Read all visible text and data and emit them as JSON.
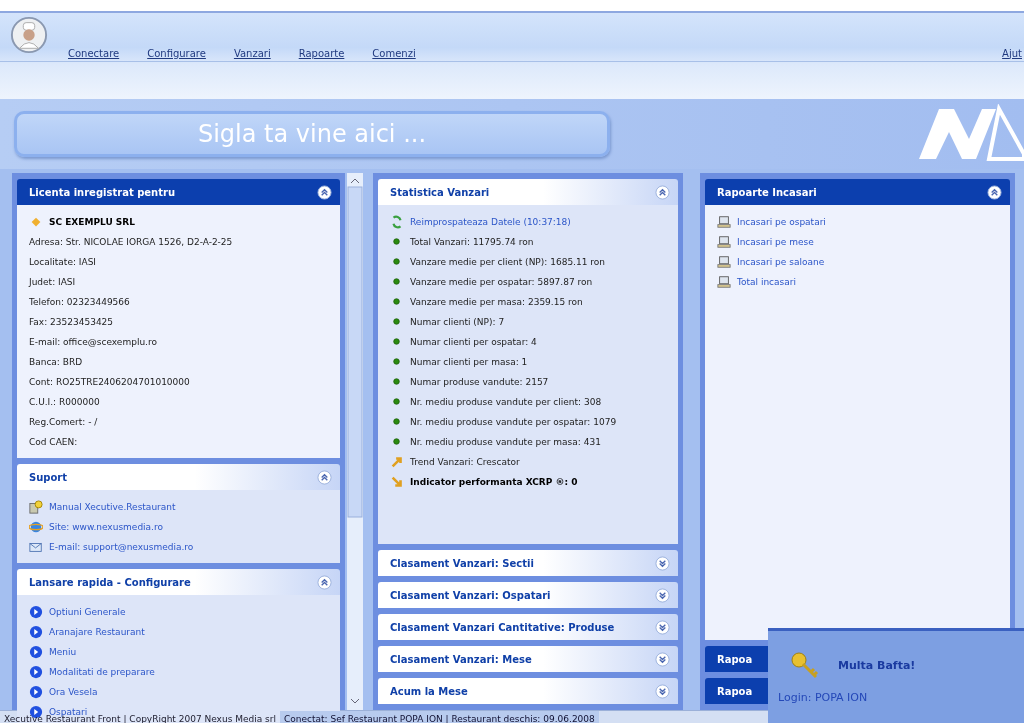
{
  "menu": {
    "items": [
      "Conectare",
      "Configurare",
      "Vanzari",
      "Rapoarte",
      "Comenzi"
    ],
    "help": "Ajut"
  },
  "banner": {
    "text": "Sigla ta vine aici ..."
  },
  "left_panels": [
    {
      "title": "Licenta inregistrat pentru",
      "expanded": true,
      "kind": "info",
      "company": "SC EXEMPLU SRL",
      "lines": [
        "Adresa: Str. NICOLAE IORGA 1526, D2-A-2-25",
        "Localitate: IASI",
        "Judet: IASI",
        "Telefon: 02323449566",
        "Fax: 23523453425",
        "E-mail: office@scexemplu.ro",
        "Banca: BRD",
        "Cont: RO25TRE2406204701010000",
        "C.U.I.: R000000",
        "Reg.Comert:  -   /",
        "Cod CAEN:"
      ]
    },
    {
      "title": "Suport",
      "expanded": true,
      "kind": "support",
      "items": [
        "Manual Xecutive.Restaurant",
        "Site: www.nexusmedia.ro",
        "E-mail: support@nexusmedia.ro"
      ]
    },
    {
      "title": "Lansare rapida - Configurare",
      "expanded": true,
      "kind": "quick",
      "items": [
        "Optiuni Generale",
        "Aranajare Restaurant",
        "Meniu",
        "Modalitati de preparare",
        "Ora Vesela",
        "Ospatari"
      ]
    }
  ],
  "middle_panels": [
    {
      "title": "Statistica Vanzari",
      "expanded": true,
      "kind": "stats",
      "items": [
        {
          "kind": "refresh",
          "text": "Reimprospateaza Datele (10:37:18)"
        },
        {
          "kind": "dot",
          "text": "Total Vanzari: 11795.74 ron"
        },
        {
          "kind": "dot",
          "text": "Vanzare medie per client (NP): 1685.11 ron"
        },
        {
          "kind": "dot",
          "text": "Vanzare medie per ospatar: 5897.87 ron"
        },
        {
          "kind": "dot",
          "text": "Vanzare medie per masa: 2359.15 ron"
        },
        {
          "kind": "dot",
          "text": "Numar clienti (NP): 7"
        },
        {
          "kind": "dot",
          "text": "Numar clienti per ospatar: 4"
        },
        {
          "kind": "dot",
          "text": "Numar clienti per masa: 1"
        },
        {
          "kind": "dot",
          "text": "Numar produse vandute: 2157"
        },
        {
          "kind": "dot",
          "text": "Nr. mediu produse vandute per client: 308"
        },
        {
          "kind": "dot",
          "text": "Nr. mediu produse vandute per ospatar: 1079"
        },
        {
          "kind": "dot",
          "text": "Nr. mediu produse vandute per masa: 431"
        },
        {
          "kind": "trend",
          "text": "Trend Vanzari: Crescator"
        },
        {
          "kind": "indicator",
          "text": "Indicator performanta XCRP ®: 0"
        }
      ]
    },
    {
      "title": "Clasament Vanzari: Sectii",
      "expanded": false,
      "kind": "section"
    },
    {
      "title": "Clasament Vanzari: Ospatari",
      "expanded": false,
      "kind": "section"
    },
    {
      "title": "Clasament Vanzari Cantitative: Produse",
      "expanded": false,
      "kind": "section"
    },
    {
      "title": "Clasament Vanzari: Mese",
      "expanded": false,
      "kind": "section"
    },
    {
      "title": "Acum la Mese",
      "expanded": false,
      "kind": "section"
    }
  ],
  "right_panels": [
    {
      "title": "Rapoarte Incasari",
      "expanded": true,
      "kind": "reports",
      "items": [
        "Incasari pe ospatari",
        "Incasari pe mese",
        "Incasari pe saloane",
        "Total incasari"
      ]
    },
    {
      "title": "Rapoa",
      "kind": "report"
    },
    {
      "title": "Rapoa",
      "kind": "report"
    }
  ],
  "notification": {
    "title": "Multa Bafta!",
    "login": "Login: POPA ION"
  },
  "status_bar": {
    "left": "Xecutive Restaurant Front | CopyRight 2007 Nexus Media srl",
    "right": "Conectat: Sef Restaurant POPA ION  |  Restaurant deschis: 09.06.2008"
  }
}
